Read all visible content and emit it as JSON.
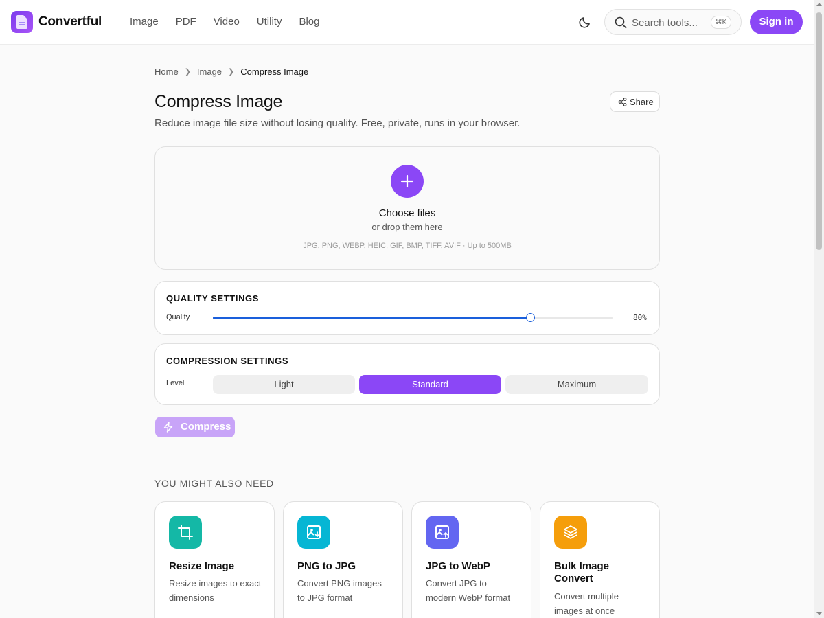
{
  "header": {
    "brand": "Convertful",
    "nav": [
      "Image",
      "PDF",
      "Video",
      "Utility",
      "Blog"
    ],
    "search_placeholder": "Search tools...",
    "search_shortcut": "⌘K",
    "signin_label": "Sign in"
  },
  "breadcrumb": [
    "Home",
    "Image",
    "Compress Image"
  ],
  "page": {
    "title": "Compress Image",
    "subtitle": "Reduce image file size without losing quality. Free, private, runs in your browser.",
    "share_label": "Share"
  },
  "dropzone": {
    "choose_label": "Choose files",
    "drop_label": "or drop them here",
    "formats": "JPG, PNG, WEBP, HEIC, GIF, BMP, TIFF, AVIF  ·  Up to 500MB"
  },
  "quality": {
    "title": "QUALITY SETTINGS",
    "label": "Quality",
    "value": 80,
    "value_text": "80%"
  },
  "compression": {
    "title": "COMPRESSION SETTINGS",
    "label": "Level",
    "options": [
      "Light",
      "Standard",
      "Maximum"
    ],
    "selected": "Standard"
  },
  "compress_label": "Compress",
  "related": {
    "heading": "YOU MIGHT ALSO NEED",
    "tools": [
      {
        "name": "Resize Image",
        "desc": "Resize images to exact dimensions",
        "icon": "crop-icon",
        "color": "#14b8a6"
      },
      {
        "name": "PNG to JPG",
        "desc": "Convert PNG images to JPG format",
        "icon": "image-convert-icon",
        "color": "#06b6d4"
      },
      {
        "name": "JPG to WebP",
        "desc": "Convert JPG to modern WebP format",
        "icon": "image-upload-icon",
        "color": "#6366f1"
      },
      {
        "name": "Bulk Image Convert",
        "desc": "Convert multiple images at once",
        "icon": "layers-icon",
        "color": "#f59e0b"
      }
    ]
  },
  "colors": {
    "accent": "#8b47f6",
    "slider": "#1a5fdb"
  }
}
